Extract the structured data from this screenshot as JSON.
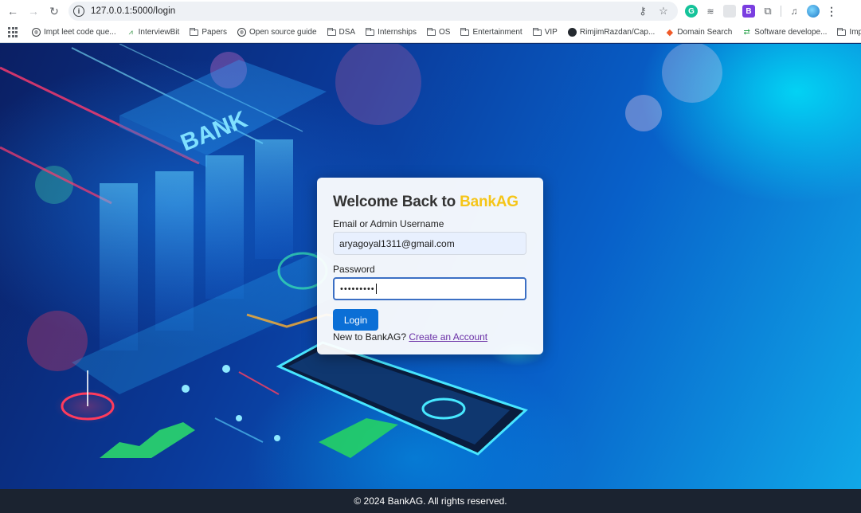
{
  "browser": {
    "url": "127.0.0.1:5000/login",
    "bookmarks": [
      {
        "label": "Impt leet code que...",
        "icon": "globe"
      },
      {
        "label": "InterviewBit",
        "icon": "interviewbit"
      },
      {
        "label": "Papers",
        "icon": "folder"
      },
      {
        "label": "Open source guide",
        "icon": "globe"
      },
      {
        "label": "DSA",
        "icon": "folder"
      },
      {
        "label": "Internships",
        "icon": "folder"
      },
      {
        "label": "OS",
        "icon": "folder"
      },
      {
        "label": "Entertainment",
        "icon": "folder"
      },
      {
        "label": "VIP",
        "icon": "folder"
      },
      {
        "label": "RimjimRazdan/Cap...",
        "icon": "github"
      },
      {
        "label": "Domain Search",
        "icon": "domain-search"
      },
      {
        "label": "Software develope...",
        "icon": "software-dev"
      },
      {
        "label": "Impt",
        "icon": "folder"
      }
    ]
  },
  "background": {
    "sign_text": "BANK"
  },
  "login": {
    "title_prefix": "Welcome Back to ",
    "title_brand": "BankAG",
    "email_label": "Email or Admin Username",
    "email_value": "aryagoyal1311@gmail.com",
    "password_label": "Password",
    "password_masked": "•••••••••",
    "login_button": "Login",
    "signup_prompt": "New to BankAG? ",
    "signup_link": "Create an Account",
    "brand_color": "#f5c518",
    "button_color": "#0b6fd6"
  },
  "footer": {
    "text": "© 2024 BankAG. All rights reserved."
  }
}
